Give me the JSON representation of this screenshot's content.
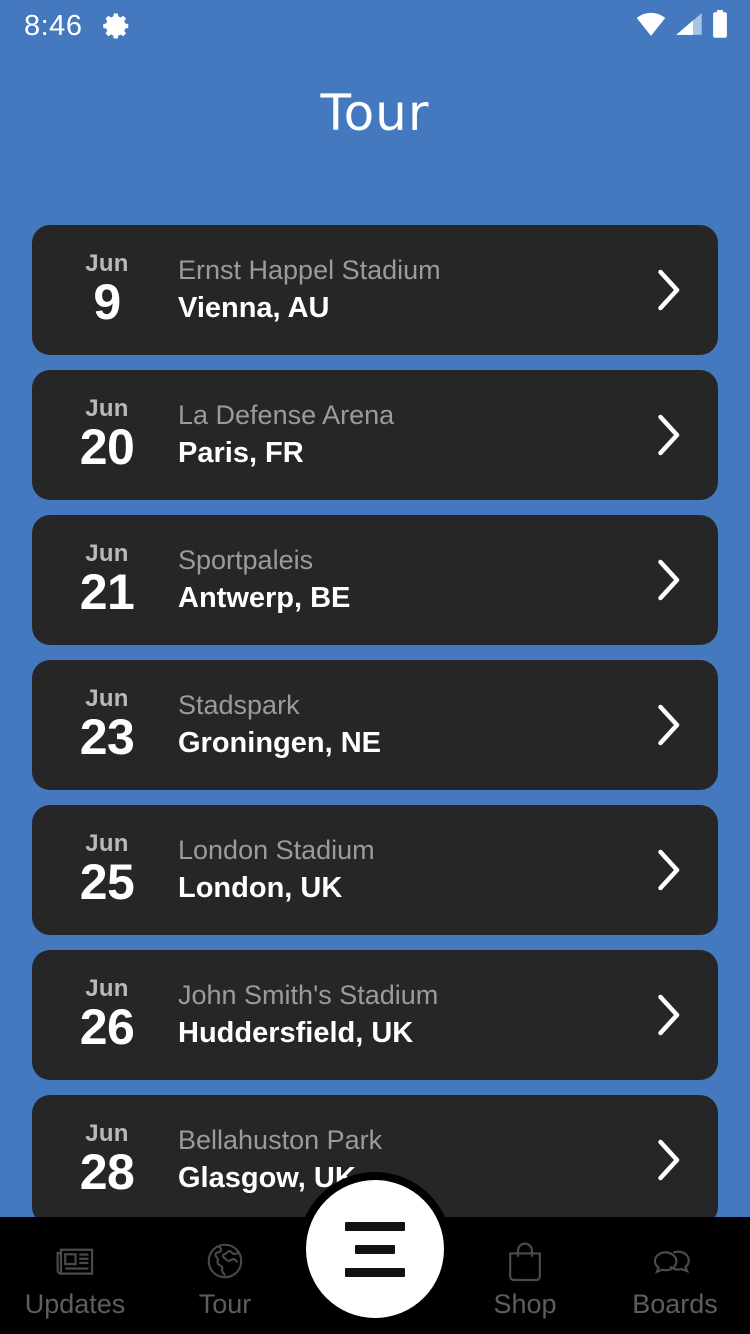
{
  "statusbar": {
    "time": "8:46",
    "gear_icon": "gear-icon",
    "wifi_icon": "wifi-icon",
    "cellular_icon": "cellular-signal-icon",
    "battery_icon": "battery-full-icon"
  },
  "header": {
    "title": "Tour"
  },
  "colors": {
    "background": "#4479c0",
    "card": "#262626",
    "card_title": "#ffffff",
    "card_subtitle": "#9b9b9b",
    "nav_bar": "#000000",
    "nav_label": "#5e5e5e",
    "fab": "#ffffff"
  },
  "tour": {
    "chevron_icon": "chevron-right-icon",
    "dates": [
      {
        "month": "Jun",
        "day": "9",
        "venue": "Ernst Happel Stadium",
        "city": "Vienna, AU"
      },
      {
        "month": "Jun",
        "day": "20",
        "venue": "La Defense Arena",
        "city": "Paris, FR"
      },
      {
        "month": "Jun",
        "day": "21",
        "venue": "Sportpaleis",
        "city": "Antwerp, BE"
      },
      {
        "month": "Jun",
        "day": "23",
        "venue": "Stadspark",
        "city": "Groningen, NE"
      },
      {
        "month": "Jun",
        "day": "25",
        "venue": "London Stadium",
        "city": "London, UK"
      },
      {
        "month": "Jun",
        "day": "26",
        "venue": "John Smith's Stadium",
        "city": "Huddersfield, UK"
      },
      {
        "month": "Jun",
        "day": "28",
        "venue": "Bellahuston Park",
        "city": "Glasgow, UK"
      }
    ]
  },
  "bottomnav": {
    "items": [
      {
        "label": "Updates",
        "icon": "newspaper-icon"
      },
      {
        "label": "Tour",
        "icon": "globe-icon"
      },
      {
        "label": "Shop",
        "icon": "shopping-bag-icon"
      },
      {
        "label": "Boards",
        "icon": "chat-bubbles-icon"
      }
    ],
    "fab": {
      "icon": "menu-lines-icon"
    }
  }
}
